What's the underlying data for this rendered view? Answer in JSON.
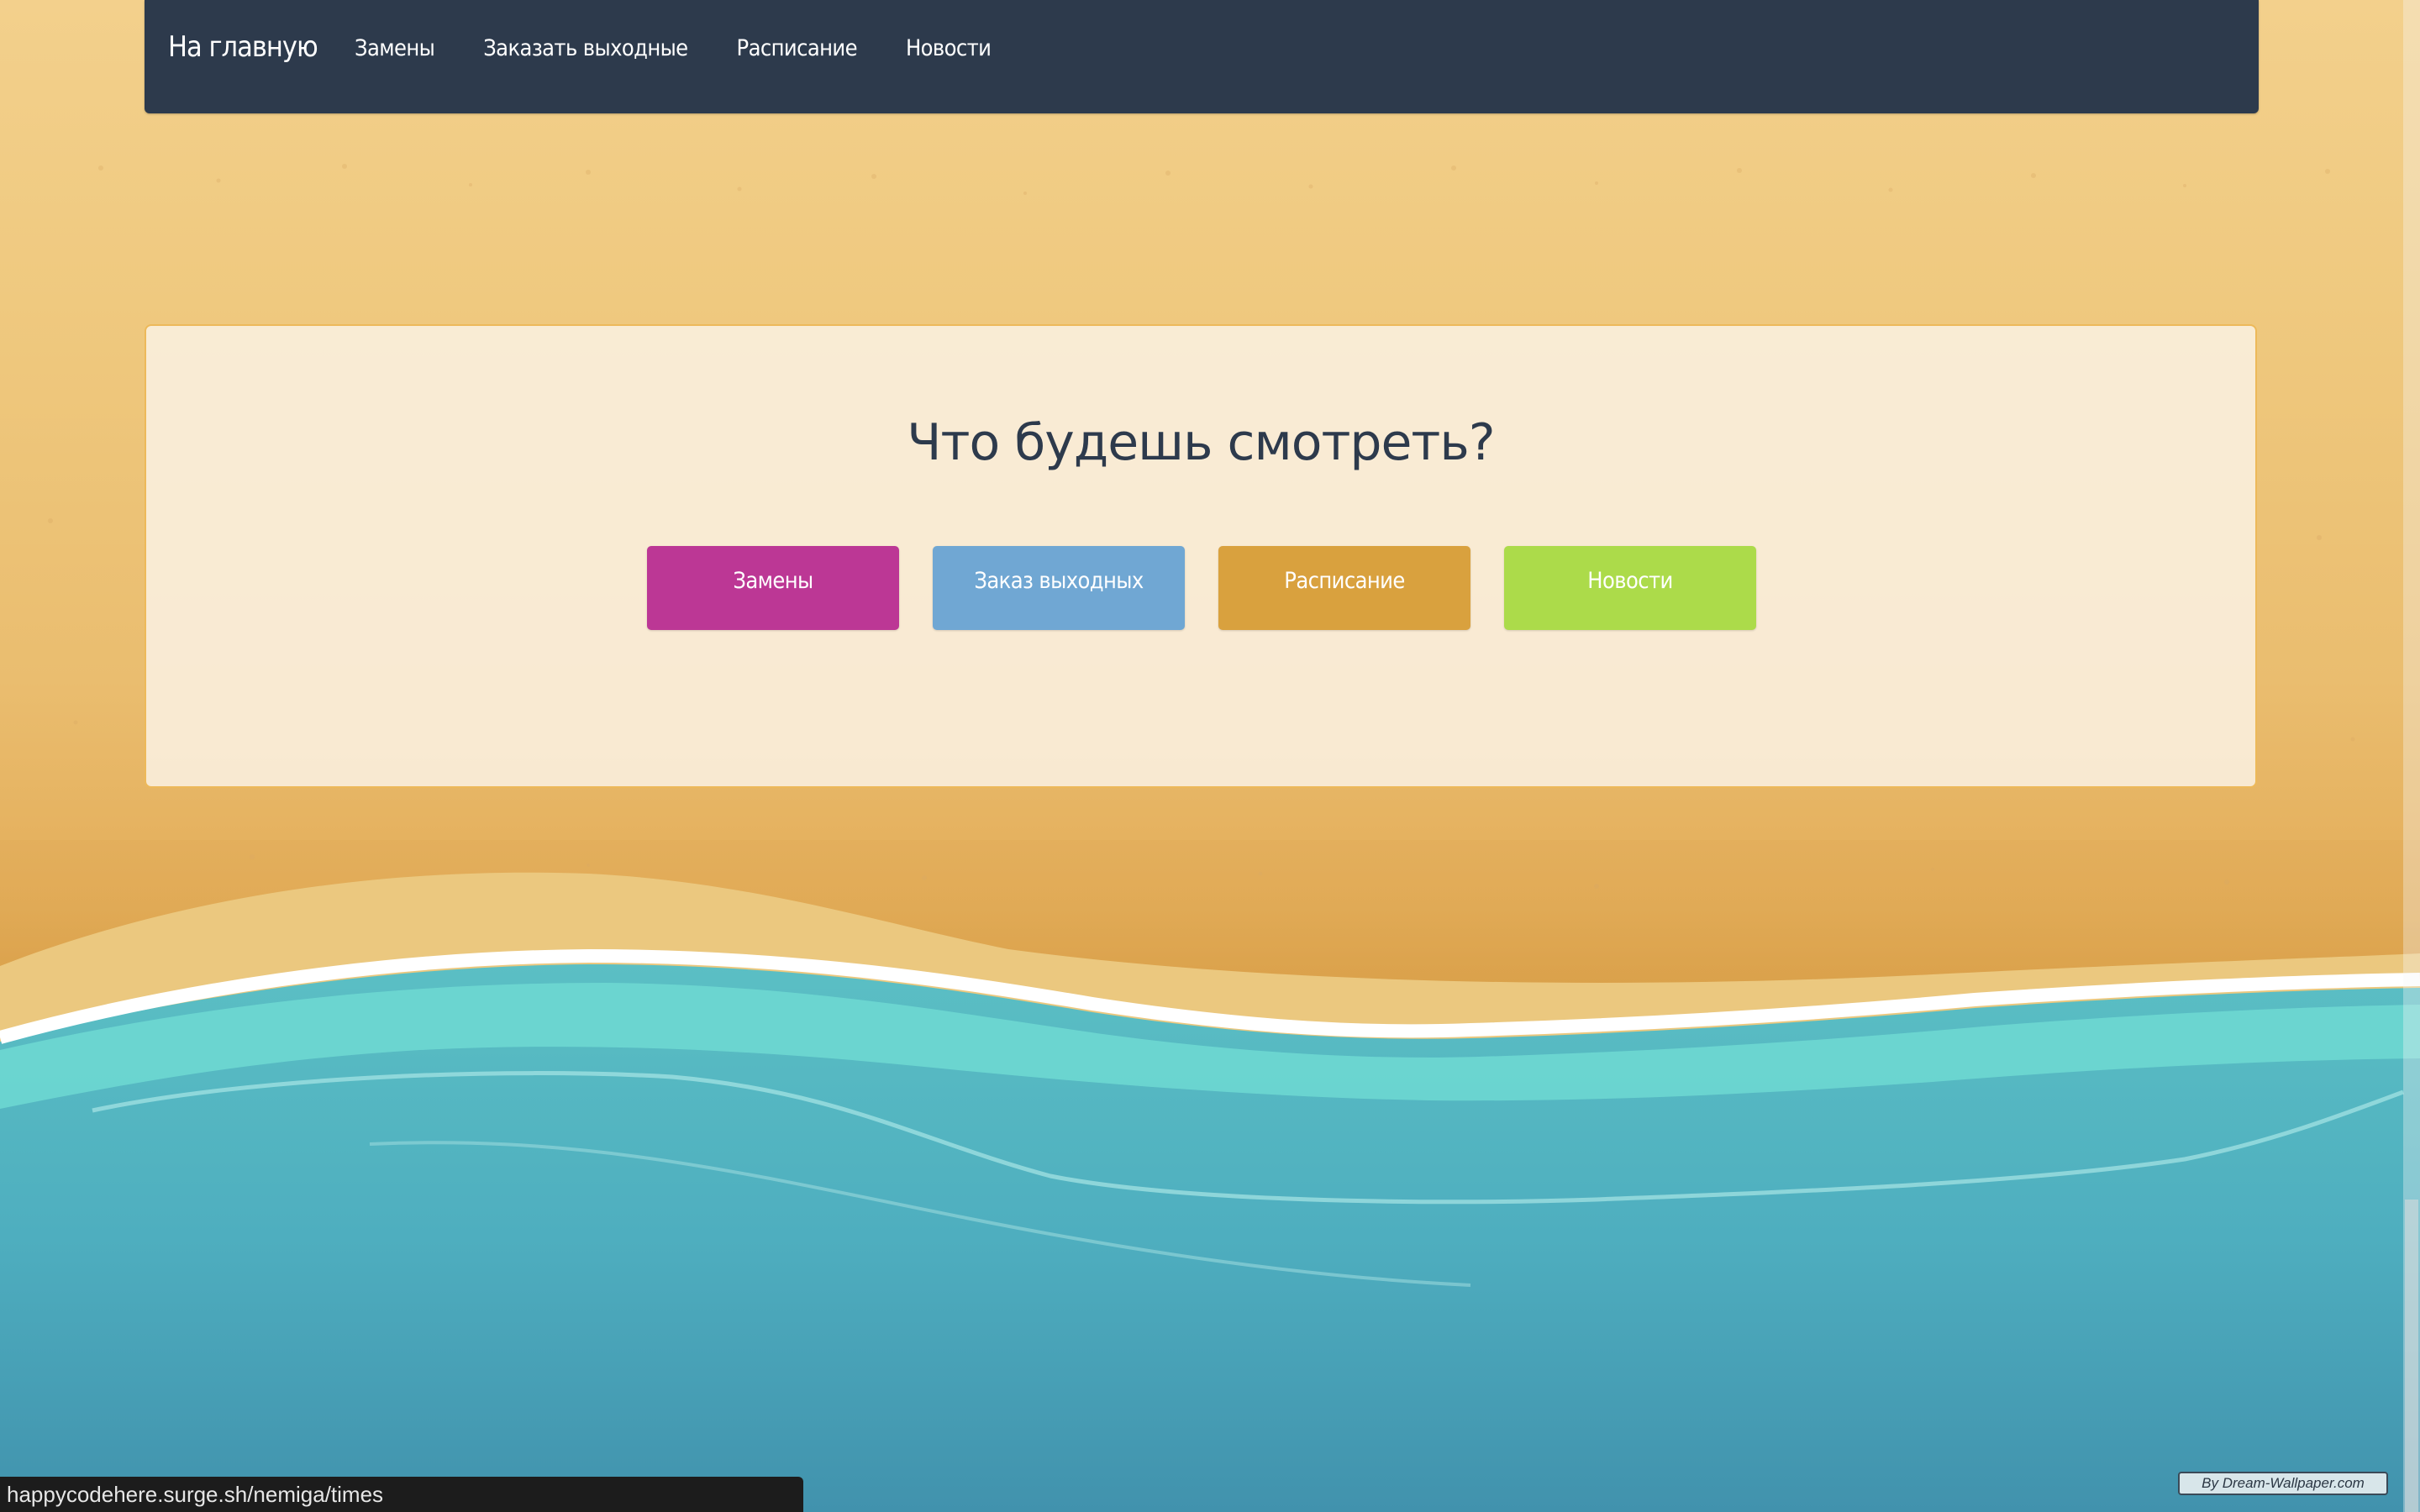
{
  "navbar": {
    "brand": "На главную",
    "links": [
      "Замены",
      "Заказать выходные",
      "Расписание",
      "Новости"
    ]
  },
  "card": {
    "title": "Что будешь смотреть?",
    "buttons": [
      {
        "label": "Замены",
        "color": "#bc3795"
      },
      {
        "label": "Заказ выходных",
        "color": "#70a7d3"
      },
      {
        "label": "Расписание",
        "color": "#d9a13e"
      },
      {
        "label": "Новости",
        "color": "#acdb4a"
      }
    ]
  },
  "status_bar": {
    "url": "happycodehere.surge.sh/nemiga/times"
  },
  "watermark": {
    "text": "By Dream-Wallpaper.com"
  },
  "colors": {
    "navbar_bg": "#2d3a4c",
    "sand": "#efc97f",
    "water": "#4fb1c2",
    "foam": "#ffffff"
  }
}
